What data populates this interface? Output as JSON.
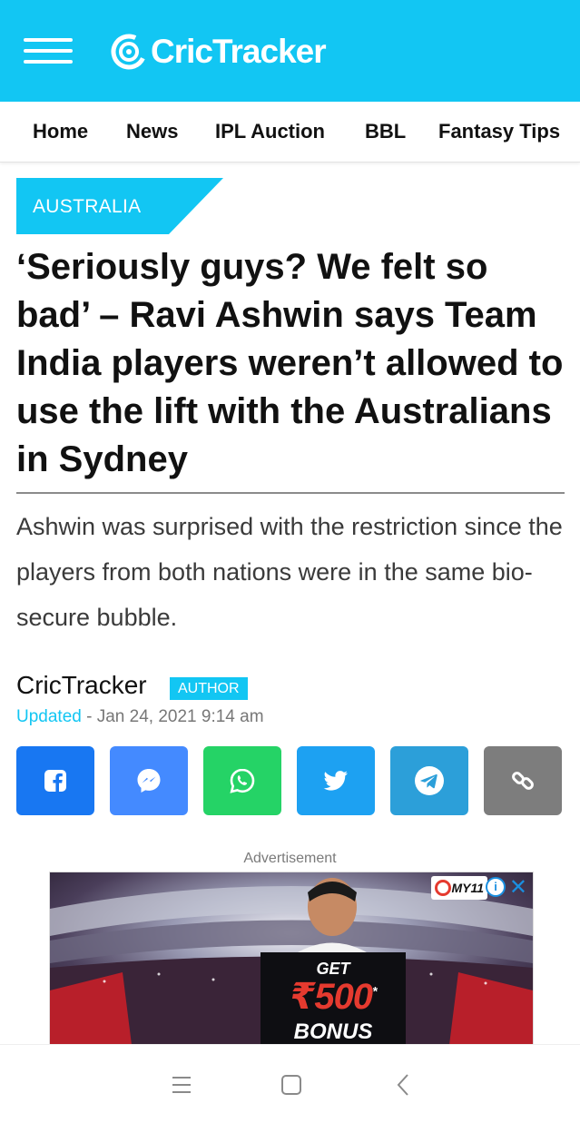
{
  "header": {
    "logo_text": "CricTracker",
    "bg_color": "#12c6f3"
  },
  "nav": {
    "items": [
      "Home",
      "News",
      "IPL Auction",
      "BBL",
      "Fantasy Tips"
    ]
  },
  "article": {
    "category": "AUSTRALIA",
    "headline": "‘Seriously guys? We felt so bad’ – Ravi Ashwin says Team India players weren’t allowed to use the lift with the Australians in Sydney",
    "subheading": "Ashwin was surprised with the restriction since the players from both nations were in the same bio-secure bubble.",
    "author": "CricTracker",
    "author_badge": "AUTHOR",
    "updated_label": "Updated",
    "updated_date": "- Jan 24, 2021 9:14 am"
  },
  "share_buttons": [
    {
      "name": "facebook",
      "icon": "facebook-icon",
      "color": "#1877f2"
    },
    {
      "name": "messenger",
      "icon": "messenger-icon",
      "color": "#448aff"
    },
    {
      "name": "whatsapp",
      "icon": "whatsapp-icon",
      "color": "#25d366"
    },
    {
      "name": "twitter",
      "icon": "twitter-icon",
      "color": "#1da1f2"
    },
    {
      "name": "telegram",
      "icon": "telegram-icon",
      "color": "#2c9fd9"
    },
    {
      "name": "copy-link",
      "icon": "link-icon",
      "color": "#7d7d7d"
    }
  ],
  "ad": {
    "label": "Advertisement",
    "get": "GET",
    "amount": "₹500",
    "asterisk": "*",
    "bonus": "BONUS",
    "brand": "MY11"
  },
  "system_nav": {
    "icons": [
      "menu-icon",
      "home-icon",
      "back-icon"
    ]
  }
}
